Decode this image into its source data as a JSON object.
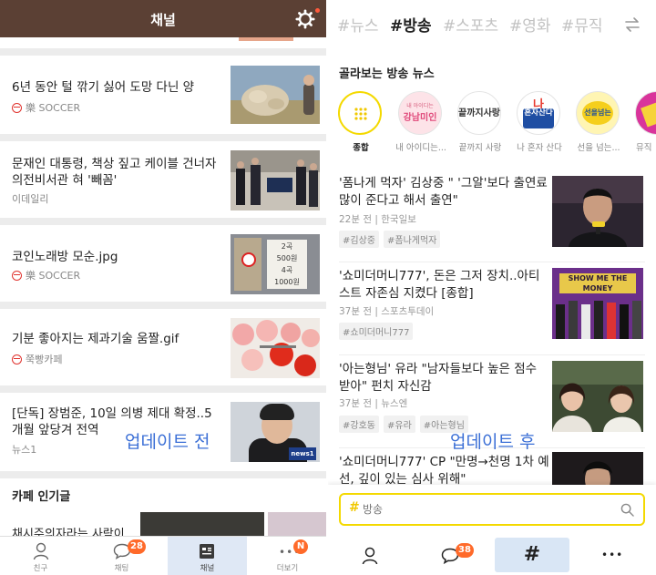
{
  "left": {
    "header": {
      "title": "채널"
    },
    "feed": [
      {
        "title": "6년 동안 털 깎기 싫어 도망 다닌 양",
        "source": "樂 SOCCER",
        "source_icon": true
      },
      {
        "title": "문재인 대통령, 책상 짚고 케이블 건너자 의전비서관 혀 '빼꼼'",
        "source": "이데일리",
        "source_icon": false
      },
      {
        "title": "코인노래방 모순.jpg",
        "source": "樂 SOCCER",
        "source_icon": true
      },
      {
        "title": "기분 좋아지는 제과기술 움짤.gif",
        "source": "쭉빵카페",
        "source_icon": true
      },
      {
        "title": "[단독] 장범준, 10일 의병 제대 확정..5개월 앞당겨 전역",
        "source": "뉴스1",
        "source_icon": false
      }
    ],
    "coin_thumb": {
      "row1": "2곡",
      "row2": "500원",
      "row3": "4곡",
      "row4": "1000원"
    },
    "news1_logo": "news1",
    "annotation": "업데이트 전",
    "cafe": {
      "title": "카페 인기글",
      "preview": "채시주의자라는 사람이"
    },
    "nav": [
      {
        "label": "친구",
        "icon": "person-icon",
        "badge": ""
      },
      {
        "label": "채팅",
        "icon": "chat-icon",
        "badge": "28"
      },
      {
        "label": "채널",
        "icon": "channel-icon",
        "badge": "",
        "active": true
      },
      {
        "label": "더보기",
        "icon": "more-icon",
        "badge": "N"
      }
    ]
  },
  "right": {
    "tabs": [
      "#뉴스",
      "#방송",
      "#스포츠",
      "#영화",
      "#뮤직"
    ],
    "active_tab": 1,
    "section_title": "골라보는 방송 뉴스",
    "channels": [
      {
        "label": "종합",
        "art": "",
        "active": true
      },
      {
        "label": "내 아이디는...",
        "art": "강남미인"
      },
      {
        "label": "끝까지 사랑",
        "art": "끝까지사랑"
      },
      {
        "label": "나 혼자 산다",
        "art": "혼자산다"
      },
      {
        "label": "선을 넘는...",
        "art": "선을넘는"
      },
      {
        "label": "뮤직",
        "art": ""
      }
    ],
    "channel_badge_top": "나",
    "gangnam_top": "내 아이디는",
    "news": [
      {
        "title": "'폼나게 먹자' 김상중 \" '그알'보다 출연료 많이 준다고 해서 출연\"",
        "time": "22분 전",
        "source": "한국일보",
        "tags": [
          "#김상중",
          "#폼나게먹자"
        ]
      },
      {
        "title": "'쇼미더머니777', 돈은 그저 장치..아티스트 자존심 지켰다 [종합]",
        "time": "37분 전",
        "source": "스포츠투데이",
        "tags": [
          "#쇼미더머니777"
        ]
      },
      {
        "title": "'아는형님' 유라 \"남자들보다 높은 점수 받아\" 펀치 자신감",
        "time": "37분 전",
        "source": "뉴스엔",
        "tags": [
          "#강호동",
          "#유라",
          "#아는형님"
        ]
      },
      {
        "title": "'쇼미더머니777' CP \"만명→천명 1차 예선, 깊이 있는 심사 위해\"",
        "time": "",
        "source": "",
        "tags": []
      }
    ],
    "thumb_text": "SHOW ME THE MONEY",
    "annotation": "업데이트 후",
    "search": {
      "placeholder": "방송",
      "hash": "#"
    },
    "nav": [
      {
        "icon": "person-icon",
        "badge": ""
      },
      {
        "icon": "chat-icon",
        "badge": "38"
      },
      {
        "icon": "hash-icon",
        "label": "#",
        "active": true
      },
      {
        "icon": "more-icon",
        "label": "•••"
      }
    ]
  },
  "colors": {
    "header_brown": "#5b4034",
    "badge_orange": "#ff6a2a",
    "accent_yellow": "#f4d900",
    "annotation_blue": "#3b6fd6"
  }
}
